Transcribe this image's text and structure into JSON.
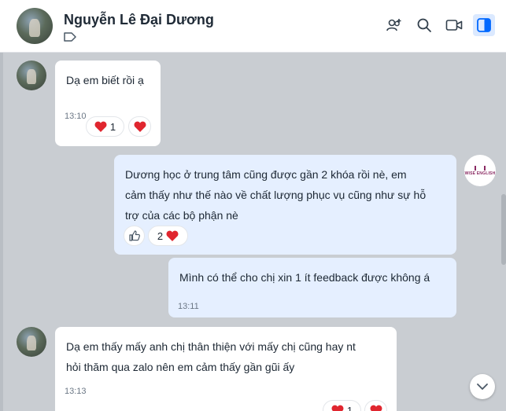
{
  "header": {
    "contact_name": "Nguyễn Lê Đại Dương",
    "icons": [
      "tag-icon",
      "add-member-icon",
      "search-icon",
      "video-call-icon",
      "sidebar-toggle-icon"
    ]
  },
  "messages": [
    {
      "sender": "contact",
      "lines": [
        "Dạ em biết rồi ạ"
      ],
      "time": "13:10",
      "reactions": {
        "summary_count": "1",
        "icon": "heart-icon"
      }
    },
    {
      "sender": "me",
      "lines": [
        "Dương học ở trung tâm cũng được gần 2 khóa rồi nè, em",
        "cảm thấy như thế nào về chất lượng phục vụ cũng như sự hỗ",
        "trợ của các bộ phận nè"
      ],
      "reactions": {
        "summary_count": "2",
        "icon": "heart-icon",
        "react_button": "like-icon"
      }
    },
    {
      "sender": "me",
      "lines": [
        "Mình có thể cho chị xin 1 ít feedback được không á"
      ],
      "time": "13:11"
    },
    {
      "sender": "contact",
      "lines": [
        "Dạ em thấy mấy anh chị thân thiện với mấy chị cũng hay nt",
        "hỏi thăm qua zalo nên em cảm thấy gần gũi ấy"
      ],
      "time": "13:13",
      "reactions": {
        "summary_count": "1",
        "icon": "heart-icon"
      }
    }
  ],
  "colors": {
    "chat_background": "#c9cdd2",
    "incoming_bubble": "#ffffff",
    "outgoing_bubble": "#e5efff",
    "heart": "#e0262f",
    "accent": "#0068ff"
  }
}
